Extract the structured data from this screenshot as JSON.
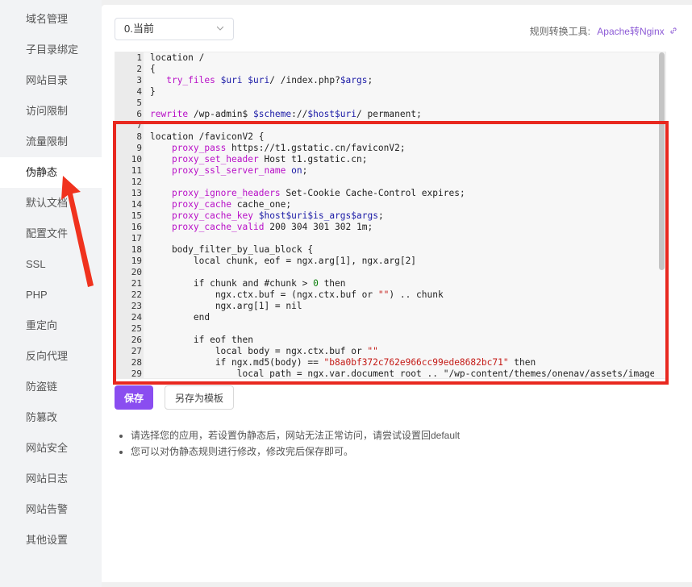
{
  "sidebar": {
    "items": [
      {
        "label": "域名管理"
      },
      {
        "label": "子目录绑定"
      },
      {
        "label": "网站目录"
      },
      {
        "label": "访问限制"
      },
      {
        "label": "流量限制"
      },
      {
        "label": "伪静态"
      },
      {
        "label": "默认文档"
      },
      {
        "label": "配置文件"
      },
      {
        "label": "SSL"
      },
      {
        "label": "PHP"
      },
      {
        "label": "重定向"
      },
      {
        "label": "反向代理"
      },
      {
        "label": "防盗链"
      },
      {
        "label": "防篡改"
      },
      {
        "label": "网站安全"
      },
      {
        "label": "网站日志"
      },
      {
        "label": "网站告警"
      },
      {
        "label": "其他设置"
      }
    ],
    "active_index": 5
  },
  "toolbar": {
    "select_value": "0.当前",
    "tool_label": "规则转换工具:",
    "tool_link": "Apache转Nginx"
  },
  "editor": {
    "line_numbers": [
      "1",
      "2",
      "3",
      "4",
      "5",
      "6",
      "7",
      "8",
      "9",
      "10",
      "11",
      "12",
      "13",
      "14",
      "15",
      "16",
      "17",
      "18",
      "19",
      "20",
      "21",
      "22",
      "23",
      "24",
      "25",
      "26",
      "27",
      "28",
      "29"
    ],
    "lines": [
      "location /",
      "{",
      "   try_files $uri $uri/ /index.php?$args;",
      "}",
      "",
      "rewrite /wp-admin$ $scheme://$host$uri/ permanent;",
      "",
      "location /faviconV2 {",
      "    proxy_pass https://t1.gstatic.cn/faviconV2;",
      "    proxy_set_header Host t1.gstatic.cn;",
      "    proxy_ssl_server_name on;",
      "",
      "    proxy_ignore_headers Set-Cookie Cache-Control expires;",
      "    proxy_cache cache_one;",
      "    proxy_cache_key $host$uri$is_args$args;",
      "    proxy_cache_valid 200 304 301 302 1m;",
      "",
      "    body_filter_by_lua_block {",
      "        local chunk, eof = ngx.arg[1], ngx.arg[2]",
      "",
      "        if chunk and #chunk > 0 then",
      "            ngx.ctx.buf = (ngx.ctx.buf or \"\") .. chunk",
      "            ngx.arg[1] = nil",
      "        end",
      "",
      "        if eof then",
      "            local body = ngx.ctx.buf or \"\"",
      "            if ngx.md5(body) == \"b8a0bf372c762e966cc99ede8682bc71\" then",
      "                local path = ngx.var.document_root .. \"/wp-content/themes/onenav/assets/images"
    ]
  },
  "buttons": {
    "save": "保存",
    "save_template": "另存为模板"
  },
  "notes": [
    "请选择您的应用，若设置伪静态后，网站无法正常访问，请尝试设置回default",
    "您可以对伪静态规则进行修改，修改完后保存即可。"
  ],
  "colors": {
    "accent": "#8a4df0",
    "highlight_border": "#e8281f",
    "arrow": "#f0321e",
    "link": "#8d5bd6"
  }
}
